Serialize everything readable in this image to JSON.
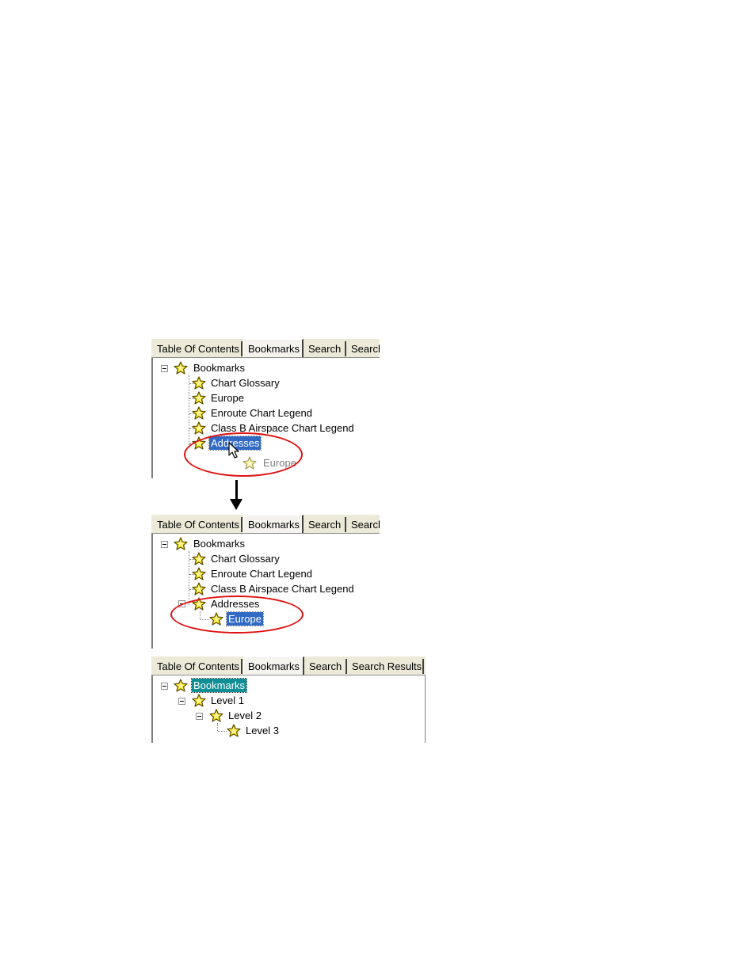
{
  "star_icon": "bookmark-star-icon",
  "colors": {
    "star_fill": "#ffe800",
    "star_stroke": "#5a4a00",
    "selection_blue": "#316ac5",
    "selection_teal": "#0f8e95",
    "annotation_red": "#e01010"
  },
  "panel1": {
    "tabs": [
      "Table Of Contents",
      "Bookmarks",
      "Search",
      "Search"
    ],
    "tree": {
      "root": "Bookmarks",
      "items": [
        "Chart Glossary",
        "Europe",
        "Enroute Chart Legend",
        "Class B Airspace Chart Legend",
        "Addresses"
      ],
      "drag_ghost": "Europe"
    }
  },
  "panel2": {
    "tabs": [
      "Table Of Contents",
      "Bookmarks",
      "Search",
      "Search"
    ],
    "tree": {
      "root": "Bookmarks",
      "items": [
        "Chart Glossary",
        "Enroute Chart Legend",
        "Class B Airspace Chart Legend",
        "Addresses"
      ],
      "child": "Europe"
    }
  },
  "panel3": {
    "tabs": [
      "Table Of Contents",
      "Bookmarks",
      "Search",
      "Search Results"
    ],
    "tree": {
      "root": "Bookmarks",
      "level1": "Level 1",
      "level2": "Level 2",
      "level3": "Level 3"
    }
  }
}
